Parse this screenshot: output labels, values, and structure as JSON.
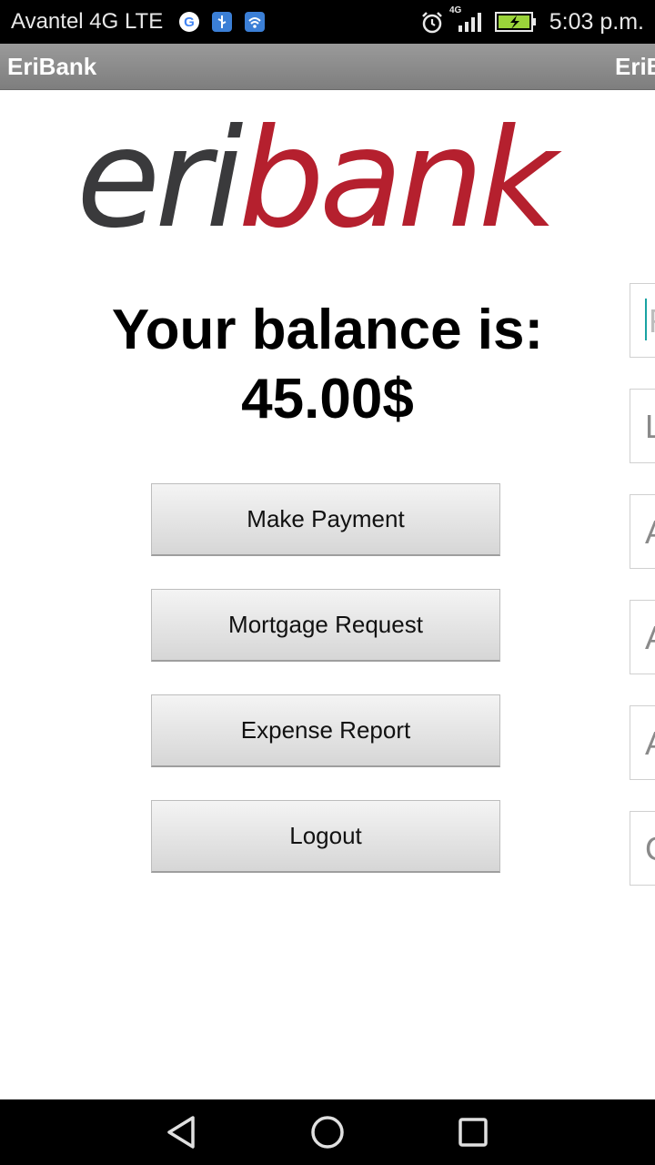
{
  "status_bar": {
    "carrier": "Avantel 4G LTE",
    "network_label": "4G",
    "time": "5:03 p.m."
  },
  "action_bar": {
    "title": "EriBank",
    "title_clipped": "EriB"
  },
  "logo": {
    "part1": "eri",
    "part2": "bank",
    "colors": {
      "part1": "#3a3a3c",
      "part2": "#b5202e"
    }
  },
  "balance": {
    "label": "Your balance is:",
    "amount": "45.00$"
  },
  "buttons": {
    "make_payment": "Make Payment",
    "mortgage_request": "Mortgage Request",
    "expense_report": "Expense Report",
    "logout": "Logout"
  },
  "side_fields": [
    {
      "visible_text": "F"
    },
    {
      "visible_text": "L"
    },
    {
      "visible_text": "A"
    },
    {
      "visible_text": "A"
    },
    {
      "visible_text": "A"
    },
    {
      "visible_text": "C"
    }
  ]
}
